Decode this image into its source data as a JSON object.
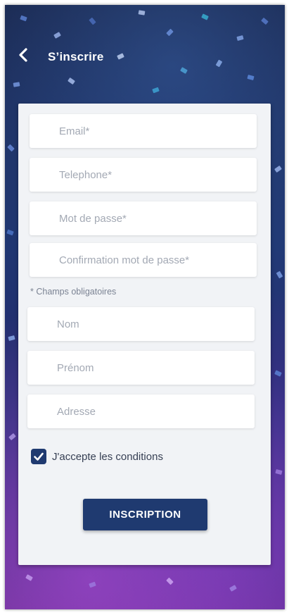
{
  "header": {
    "title": "S’inscrire",
    "back_icon": "chevron-left-icon"
  },
  "form": {
    "email_placeholder": "Email*",
    "telephone_placeholder": "Telephone*",
    "password_placeholder": "Mot de passe*",
    "confirm_password_placeholder": "Confirmation mot de passe*",
    "required_note": "* Champs obligatoires",
    "nom_placeholder": "Nom",
    "prenom_placeholder": "Prénom",
    "adresse_placeholder": "Adresse",
    "terms_label": "J'accepte les conditions",
    "terms_checked": true,
    "submit_label": "INSCRIPTION"
  },
  "colors": {
    "primary": "#1f3a70",
    "card_bg": "#f1f3f6",
    "placeholder": "#a3a9b4"
  }
}
